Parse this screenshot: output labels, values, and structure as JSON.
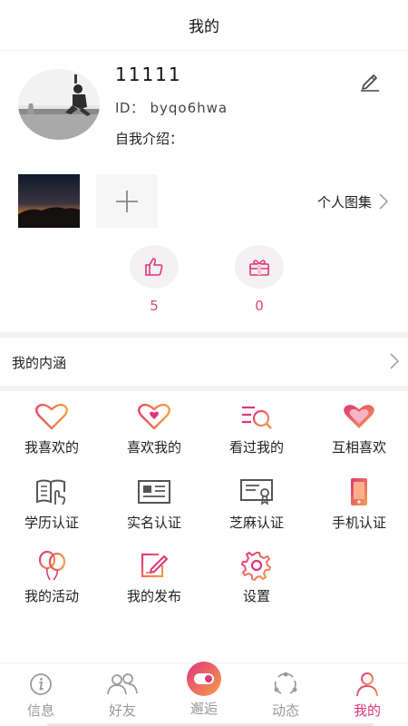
{
  "header": {
    "title": "我的"
  },
  "profile": {
    "username": "11111",
    "id_label": "ID：",
    "id_value": "byqo6hwa",
    "intro_label": "自我介绍："
  },
  "gallery": {
    "album_label": "个人图集"
  },
  "stats": {
    "likes": "5",
    "gifts": "0"
  },
  "connotation": {
    "label": "我的内涵"
  },
  "grid": [
    {
      "label": "我喜欢的",
      "icon": "heart-outline-icon"
    },
    {
      "label": "喜欢我的",
      "icon": "heart-dot-icon"
    },
    {
      "label": "看过我的",
      "icon": "list-search-icon"
    },
    {
      "label": "互相喜欢",
      "icon": "heart-filled-icon"
    },
    {
      "label": "学历认证",
      "icon": "book-hand-icon"
    },
    {
      "label": "实名认证",
      "icon": "id-card-icon"
    },
    {
      "label": "芝麻认证",
      "icon": "certificate-icon"
    },
    {
      "label": "手机认证",
      "icon": "phone-icon"
    },
    {
      "label": "我的活动",
      "icon": "balloons-icon"
    },
    {
      "label": "我的发布",
      "icon": "compose-icon"
    },
    {
      "label": "设置",
      "icon": "gear-icon"
    }
  ],
  "tabs": [
    {
      "label": "信息",
      "icon": "info-icon"
    },
    {
      "label": "好友",
      "icon": "friends-icon"
    },
    {
      "label": "邂逅",
      "icon": "toggle-icon"
    },
    {
      "label": "动态",
      "icon": "orbit-icon"
    },
    {
      "label": "我的",
      "icon": "person-icon"
    }
  ],
  "colors": {
    "accent": "#e0357a",
    "accent_orange": "#f08a4b",
    "count": "#d84a6a",
    "tab_inactive": "#999999"
  }
}
